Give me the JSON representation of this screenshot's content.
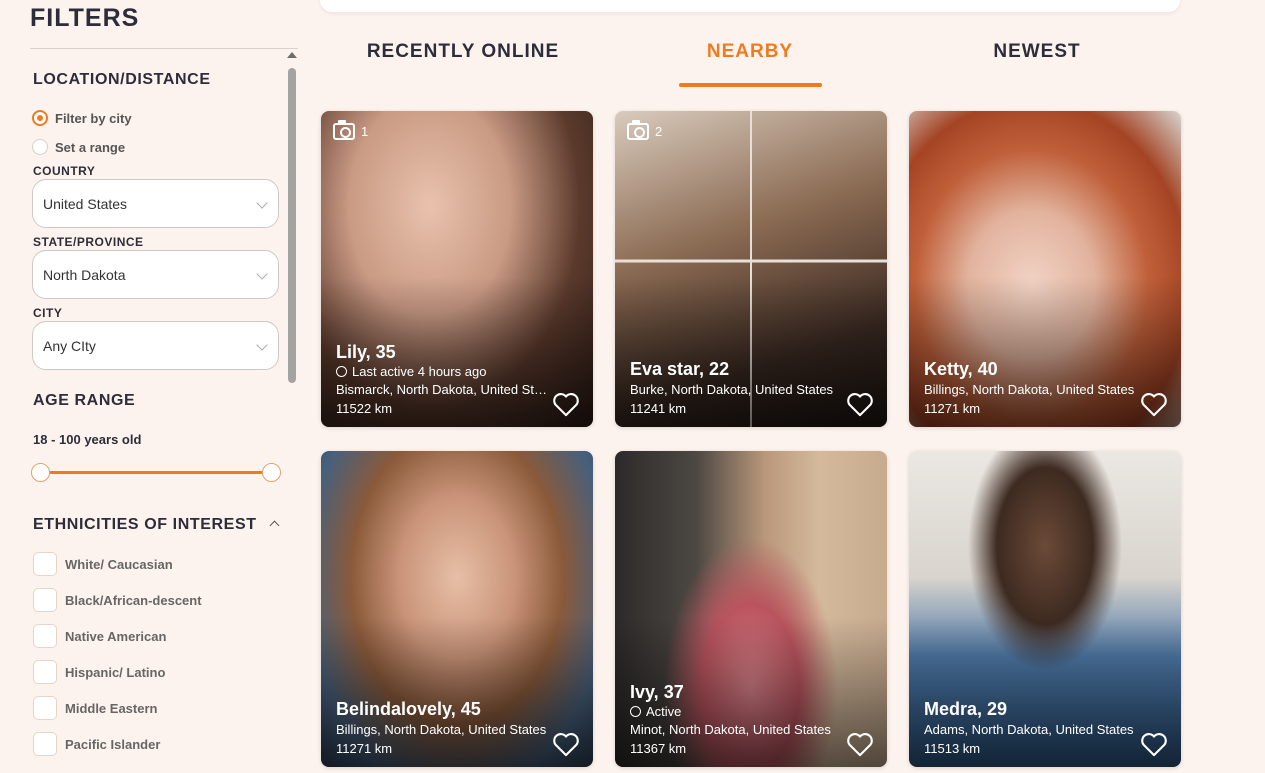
{
  "sidebar": {
    "title": "FILTERS",
    "location": {
      "title": "LOCATION/DISTANCE",
      "radio_city": "Filter by city",
      "radio_range": "Set a range",
      "country_label": "COUNTRY",
      "country_value": "United States",
      "state_label": "STATE/PROVINCE",
      "state_value": "North Dakota",
      "city_label": "CITY",
      "city_value": "Any CIty"
    },
    "age": {
      "title": "AGE RANGE",
      "value": "18 - 100 years old",
      "min": 18,
      "max": 100
    },
    "ethnicities": {
      "title": "ETHNICITIES OF INTEREST",
      "options": [
        "White/ Caucasian",
        "Black/African-descent",
        "Native American",
        "Hispanic/ Latino",
        "Middle Eastern",
        "Pacific Islander"
      ]
    }
  },
  "tabs": [
    "RECENTLY ONLINE",
    "NEARBY",
    "NEWEST"
  ],
  "active_tab": "NEARBY",
  "profiles": [
    {
      "name": "Lily, 35",
      "photos": "1",
      "status": "Last active 4 hours ago",
      "location": "Bismarck, North Dakota, United States",
      "distance": "11522 km"
    },
    {
      "name": "Eva star, 22",
      "photos": "2",
      "status": "",
      "location": "Burke, North Dakota, United States",
      "distance": "11241 km"
    },
    {
      "name": "Ketty, 40",
      "photos": "",
      "status": "",
      "location": "Billings, North Dakota, United States",
      "distance": "11271 km"
    },
    {
      "name": "Belindalovely, 45",
      "photos": "",
      "status": "",
      "location": "Billings, North Dakota, United States",
      "distance": "11271 km"
    },
    {
      "name": "Ivy, 37",
      "photos": "",
      "status": "Active",
      "location": "Minot, North Dakota, United States",
      "distance": "11367 km"
    },
    {
      "name": "Medra, 29",
      "photos": "",
      "status": "",
      "location": "Adams, North Dakota, United States",
      "distance": "11513 km"
    }
  ],
  "colors": {
    "accent": "#f07b1f",
    "background": "#fdf3ee",
    "text": "#2d2d3a"
  }
}
